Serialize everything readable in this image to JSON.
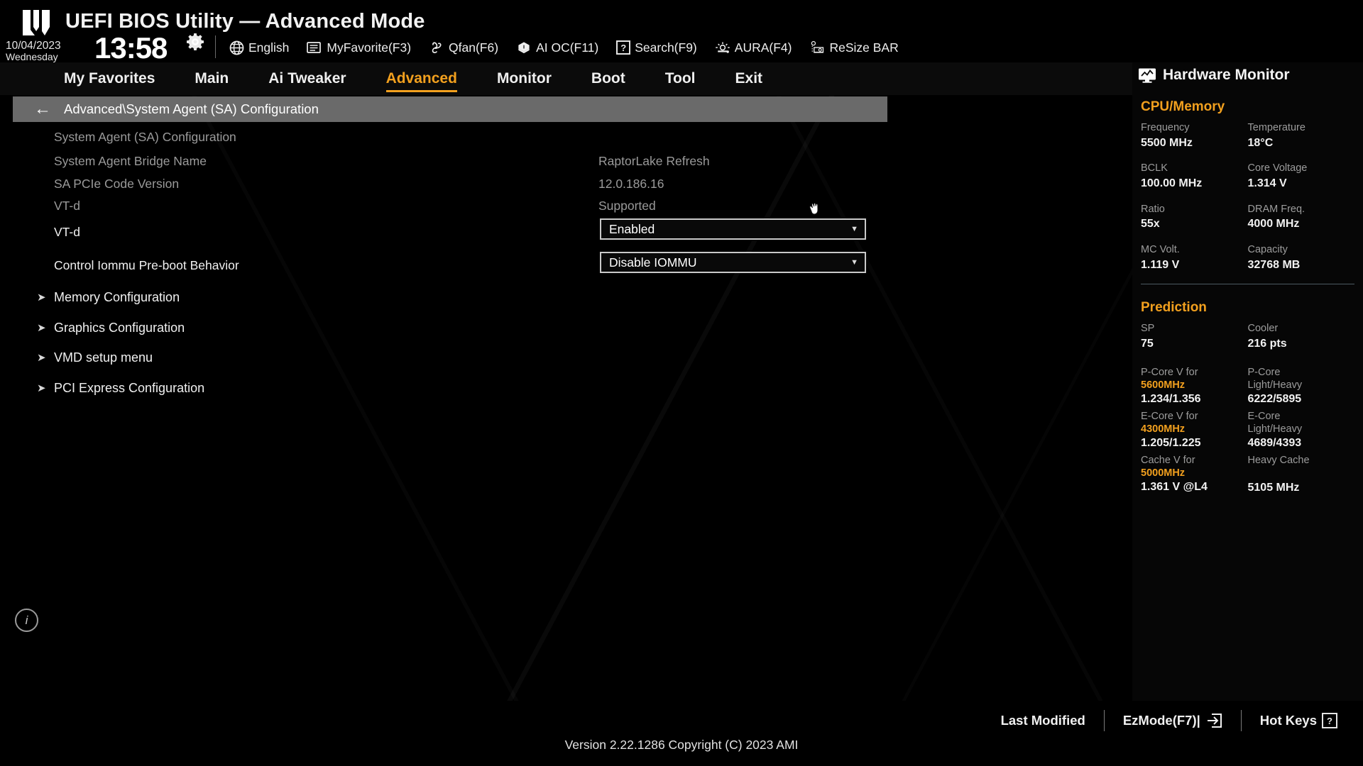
{
  "header": {
    "app_title": "UEFI BIOS Utility — Advanced Mode",
    "date": "10/04/2023",
    "weekday": "Wednesday",
    "time": "13:58",
    "gear_icon": "gear-icon",
    "tools": [
      {
        "label": "English",
        "icon": "globe-icon"
      },
      {
        "label": "MyFavorite(F3)",
        "icon": "favorites-icon"
      },
      {
        "label": "Qfan(F6)",
        "icon": "fan-icon"
      },
      {
        "label": "AI OC(F11)",
        "icon": "ai-oc-icon"
      },
      {
        "label": "Search(F9)",
        "icon": "question-box-icon"
      },
      {
        "label": "AURA(F4)",
        "icon": "aura-light-icon"
      },
      {
        "label": "ReSize BAR",
        "icon": "resize-bar-icon"
      }
    ]
  },
  "nav": {
    "items": [
      {
        "label": "My Favorites",
        "active": false
      },
      {
        "label": "Main",
        "active": false
      },
      {
        "label": "Ai Tweaker",
        "active": false
      },
      {
        "label": "Advanced",
        "active": true
      },
      {
        "label": "Monitor",
        "active": false
      },
      {
        "label": "Boot",
        "active": false
      },
      {
        "label": "Tool",
        "active": false
      },
      {
        "label": "Exit",
        "active": false
      }
    ],
    "active_color": "#f2a01e"
  },
  "breadcrumb": {
    "back_icon": "back-arrow-icon",
    "path": "Advanced\\System Agent (SA) Configuration"
  },
  "main": {
    "section_title": "System Agent (SA) Configuration",
    "info_rows": [
      {
        "label": "System Agent Bridge Name",
        "value": "RaptorLake Refresh"
      },
      {
        "label": "SA PCIe Code Version",
        "value": "12.0.186.16"
      },
      {
        "label": "VT-d",
        "value": "Supported"
      }
    ],
    "settings": [
      {
        "label": "VT-d",
        "value": "Enabled"
      },
      {
        "label": "Control Iommu Pre-boot Behavior",
        "value": "Disable IOMMU"
      }
    ],
    "submenus": [
      {
        "label": "Memory Configuration"
      },
      {
        "label": "Graphics Configuration"
      },
      {
        "label": "VMD setup menu"
      },
      {
        "label": "PCI Express Configuration"
      }
    ],
    "info_button": "i"
  },
  "sidebar": {
    "title": "Hardware Monitor",
    "monitor_icon": "monitor-icon",
    "cpu_memory": {
      "heading": "CPU/Memory",
      "rows": [
        {
          "left_key": "Frequency",
          "left_val": "5500 MHz",
          "right_key": "Temperature",
          "right_val": "18°C"
        },
        {
          "left_key": "BCLK",
          "left_val": "100.00 MHz",
          "right_key": "Core Voltage",
          "right_val": "1.314 V"
        },
        {
          "left_key": "Ratio",
          "left_val": "55x",
          "right_key": "DRAM Freq.",
          "right_val": "4000 MHz"
        },
        {
          "left_key": "MC Volt.",
          "left_val": "1.119 V",
          "right_key": "Capacity",
          "right_val": "32768 MB"
        }
      ]
    },
    "prediction": {
      "heading": "Prediction",
      "sp_key": "SP",
      "sp_val": "75",
      "cooler_key": "Cooler",
      "cooler_val": "216 pts",
      "pcore_key1": "P-Core V for",
      "pcore_key2": "5600MHz",
      "pcore_val": "1.234/1.356",
      "pcore_r1": "P-Core",
      "pcore_r2": "Light/Heavy",
      "pcore_rval": "6222/5895",
      "ecore_key1": "E-Core V for",
      "ecore_key2": "4300MHz",
      "ecore_val": "1.205/1.225",
      "ecore_r1": "E-Core",
      "ecore_r2": "Light/Heavy",
      "ecore_rval": "4689/4393",
      "cache_key1": "Cache V for",
      "cache_key2": "5000MHz",
      "cache_val": "1.361 V @L4",
      "cache_r1": "Heavy Cache",
      "cache_rval": "5105 MHz"
    },
    "accent_color": "#f2a01e"
  },
  "footer": {
    "last_modified": "Last Modified",
    "ez_mode": "EzMode(F7)|",
    "hot_keys": "Hot Keys",
    "hot_keys_glyph": "?",
    "version": "Version 2.22.1286 Copyright (C) 2023 AMI"
  }
}
